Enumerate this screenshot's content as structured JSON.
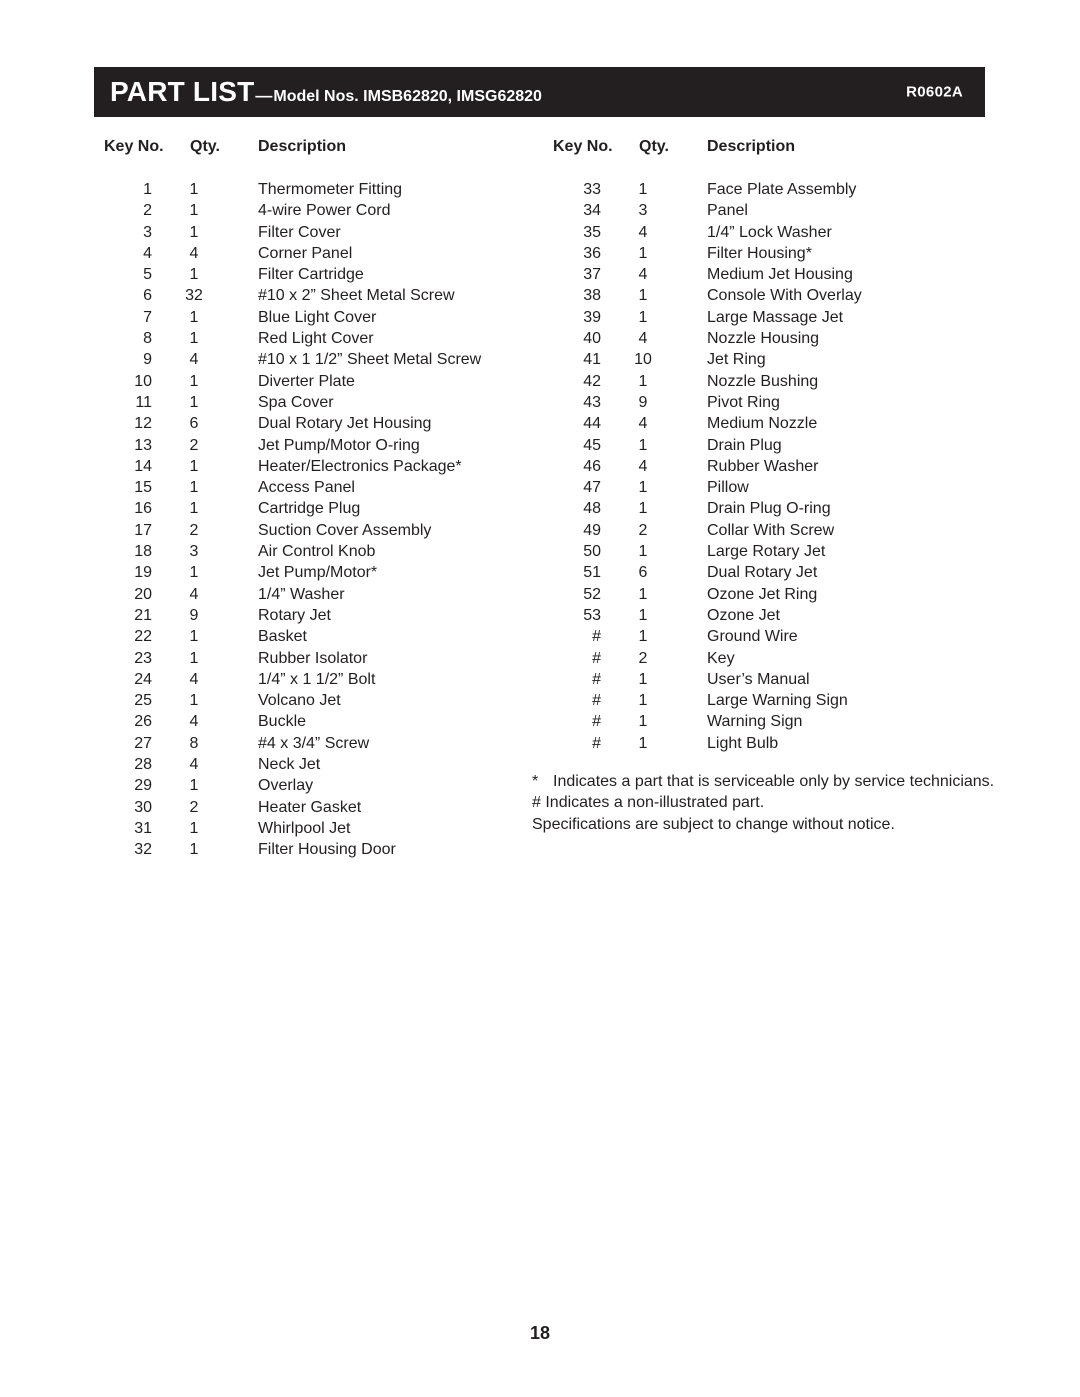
{
  "header": {
    "title": "PART LIST",
    "dash": "—",
    "subtitle": "Model Nos. IMSB62820, IMSG62820",
    "revision": "R0602A",
    "bar_color": "#231f20"
  },
  "columns": {
    "key_label": "Key No.",
    "qty_label": "Qty.",
    "desc_label": "Description"
  },
  "left_rows": [
    {
      "key": "1",
      "qty": "1",
      "desc": "Thermometer Fitting"
    },
    {
      "key": "2",
      "qty": "1",
      "desc": "4-wire Power Cord"
    },
    {
      "key": "3",
      "qty": "1",
      "desc": "Filter Cover"
    },
    {
      "key": "4",
      "qty": "4",
      "desc": "Corner Panel"
    },
    {
      "key": "5",
      "qty": "1",
      "desc": "Filter Cartridge"
    },
    {
      "key": "6",
      "qty": "32",
      "desc": "#10 x 2” Sheet Metal Screw"
    },
    {
      "key": "7",
      "qty": "1",
      "desc": "Blue Light Cover"
    },
    {
      "key": "8",
      "qty": "1",
      "desc": "Red Light Cover"
    },
    {
      "key": "9",
      "qty": "4",
      "desc": "#10 x 1 1/2” Sheet Metal Screw"
    },
    {
      "key": "10",
      "qty": "1",
      "desc": "Diverter Plate"
    },
    {
      "key": "11",
      "qty": "1",
      "desc": "Spa Cover"
    },
    {
      "key": "12",
      "qty": "6",
      "desc": "Dual Rotary Jet Housing"
    },
    {
      "key": "13",
      "qty": "2",
      "desc": "Jet Pump/Motor O-ring"
    },
    {
      "key": "14",
      "qty": "1",
      "desc": "Heater/Electronics Package*"
    },
    {
      "key": "15",
      "qty": "1",
      "desc": "Access Panel"
    },
    {
      "key": "16",
      "qty": "1",
      "desc": "Cartridge Plug"
    },
    {
      "key": "17",
      "qty": "2",
      "desc": "Suction Cover Assembly"
    },
    {
      "key": "18",
      "qty": "3",
      "desc": "Air Control Knob"
    },
    {
      "key": "19",
      "qty": "1",
      "desc": "Jet Pump/Motor*"
    },
    {
      "key": "20",
      "qty": "4",
      "desc": "1/4” Washer"
    },
    {
      "key": "21",
      "qty": "9",
      "desc": "Rotary Jet"
    },
    {
      "key": "22",
      "qty": "1",
      "desc": "Basket"
    },
    {
      "key": "23",
      "qty": "1",
      "desc": "Rubber Isolator"
    },
    {
      "key": "24",
      "qty": "4",
      "desc": "1/4” x 1 1/2” Bolt"
    },
    {
      "key": "25",
      "qty": "1",
      "desc": "Volcano Jet"
    },
    {
      "key": "26",
      "qty": "4",
      "desc": "Buckle"
    },
    {
      "key": "27",
      "qty": "8",
      "desc": "#4 x 3/4” Screw"
    },
    {
      "key": "28",
      "qty": "4",
      "desc": "Neck Jet"
    },
    {
      "key": "29",
      "qty": "1",
      "desc": "Overlay"
    },
    {
      "key": "30",
      "qty": "2",
      "desc": "Heater Gasket"
    },
    {
      "key": "31",
      "qty": "1",
      "desc": "Whirlpool Jet"
    },
    {
      "key": "32",
      "qty": "1",
      "desc": "Filter Housing Door"
    }
  ],
  "right_rows": [
    {
      "key": "33",
      "qty": "1",
      "desc": "Face Plate Assembly"
    },
    {
      "key": "34",
      "qty": "3",
      "desc": "Panel"
    },
    {
      "key": "35",
      "qty": "4",
      "desc": "1/4” Lock Washer"
    },
    {
      "key": "36",
      "qty": "1",
      "desc": "Filter Housing*"
    },
    {
      "key": "37",
      "qty": "4",
      "desc": "Medium Jet Housing"
    },
    {
      "key": "38",
      "qty": "1",
      "desc": "Console With Overlay"
    },
    {
      "key": "39",
      "qty": "1",
      "desc": "Large Massage Jet"
    },
    {
      "key": "40",
      "qty": "4",
      "desc": "Nozzle Housing"
    },
    {
      "key": "41",
      "qty": "10",
      "desc": "Jet Ring"
    },
    {
      "key": "42",
      "qty": "1",
      "desc": "Nozzle Bushing"
    },
    {
      "key": "43",
      "qty": "9",
      "desc": "Pivot Ring"
    },
    {
      "key": "44",
      "qty": "4",
      "desc": "Medium Nozzle"
    },
    {
      "key": "45",
      "qty": "1",
      "desc": "Drain Plug"
    },
    {
      "key": "46",
      "qty": "4",
      "desc": "Rubber Washer"
    },
    {
      "key": "47",
      "qty": "1",
      "desc": "Pillow"
    },
    {
      "key": "48",
      "qty": "1",
      "desc": "Drain Plug O-ring"
    },
    {
      "key": "49",
      "qty": "2",
      "desc": "Collar With Screw"
    },
    {
      "key": "50",
      "qty": "1",
      "desc": "Large Rotary Jet"
    },
    {
      "key": "51",
      "qty": "6",
      "desc": "Dual Rotary Jet"
    },
    {
      "key": "52",
      "qty": "1",
      "desc": "Ozone Jet Ring"
    },
    {
      "key": "53",
      "qty": "1",
      "desc": "Ozone Jet"
    },
    {
      "key": "#",
      "qty": "1",
      "desc": "Ground Wire"
    },
    {
      "key": "#",
      "qty": "2",
      "desc": "Key"
    },
    {
      "key": "#",
      "qty": "1",
      "desc": "User’s Manual"
    },
    {
      "key": "#",
      "qty": "1",
      "desc": "Large Warning Sign"
    },
    {
      "key": "#",
      "qty": "1",
      "desc": "Warning Sign"
    },
    {
      "key": "#",
      "qty": "1",
      "desc": "Light Bulb"
    }
  ],
  "footnotes": {
    "asterisk_mark": "*",
    "asterisk_text": "Indicates a part that is serviceable only by service technicians.",
    "hash_text": "# Indicates a non-illustrated part.",
    "specs_text": "Specifications are subject to change without notice."
  },
  "page_number": "18"
}
